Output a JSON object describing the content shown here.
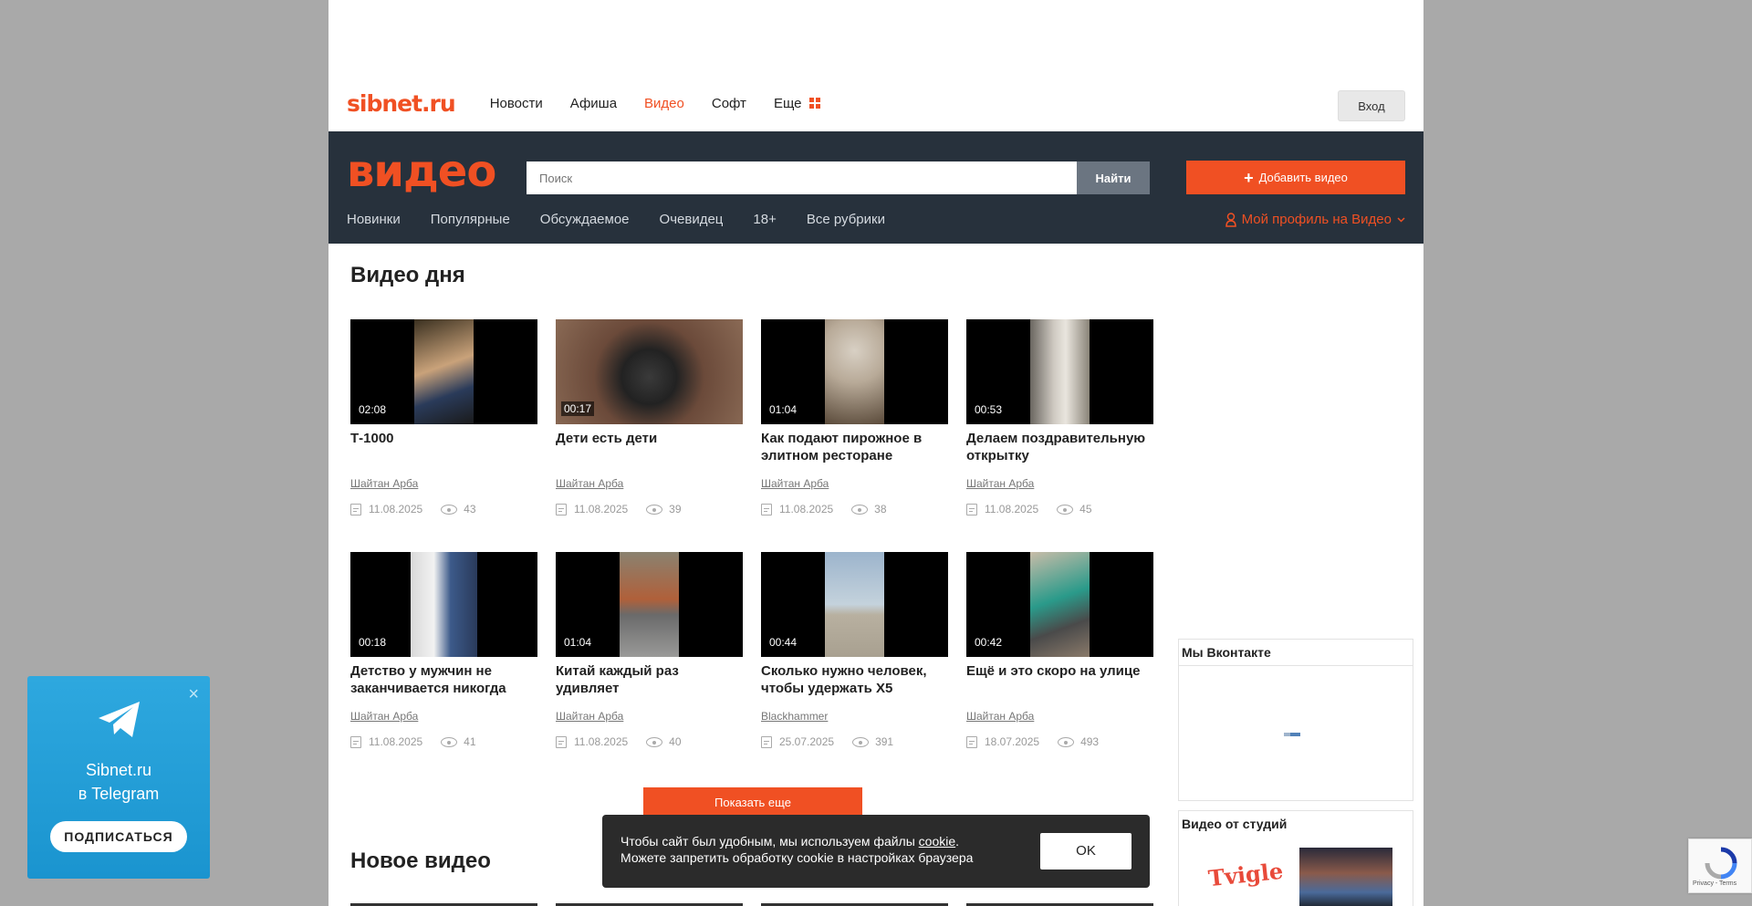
{
  "header": {
    "logo": "sibnet.ru",
    "nav": [
      "Новости",
      "Афиша",
      "Видео",
      "Софт",
      "Еще"
    ],
    "active_nav": "Видео",
    "login": "Вход"
  },
  "video_header": {
    "logo": "видео",
    "search_placeholder": "Поиск",
    "search_button": "Найти",
    "add_button": "Добавить видео",
    "subnav": [
      "Новинки",
      "Популярные",
      "Обсуждаемое",
      "Очевидец",
      "18+",
      "Все рубрики"
    ],
    "profile": "Мой профиль на Видео"
  },
  "sections": {
    "video_of_day": "Видео дня",
    "new_video": "Новое видео",
    "show_more": "Показать еще"
  },
  "videos": [
    {
      "title": "Т-1000",
      "author": "Шайтан Арба",
      "date": "11.08.2025",
      "views": "43",
      "duration": "02:08"
    },
    {
      "title": "Дети есть дети",
      "author": "Шайтан Арба",
      "date": "11.08.2025",
      "views": "39",
      "duration": "00:17"
    },
    {
      "title": "Как подают пирожное в элитном ресторане",
      "author": "Шайтан Арба",
      "date": "11.08.2025",
      "views": "38",
      "duration": "01:04"
    },
    {
      "title": "Делаем поздравительную открытку",
      "author": "Шайтан Арба",
      "date": "11.08.2025",
      "views": "45",
      "duration": "00:53"
    },
    {
      "title": "Детство у мужчин не заканчивается никогда",
      "author": "Шайтан Арба",
      "date": "11.08.2025",
      "views": "41",
      "duration": "00:18"
    },
    {
      "title": "Китай каждый раз удивляет",
      "author": "Шайтан Арба",
      "date": "11.08.2025",
      "views": "40",
      "duration": "01:04"
    },
    {
      "title": "Сколько нужно человек, чтобы удержать Х5",
      "author": "Blackhammer",
      "date": "25.07.2025",
      "views": "391",
      "duration": "00:44"
    },
    {
      "title": "Ещё и это скоро на улице",
      "author": "Шайтан Арба",
      "date": "18.07.2025",
      "views": "493",
      "duration": "00:42"
    }
  ],
  "sidebar": {
    "vk_title": "Мы Вконтакте",
    "studios_title": "Видео от студий",
    "studio_logo": "Tvigle"
  },
  "cookie": {
    "line1_prefix": "Чтобы сайт был удобным, мы используем файлы ",
    "line1_link": "cookie",
    "line1_suffix": ".",
    "line2": "Можете запретить обработку cookie в настройках браузера",
    "ok": "OK"
  },
  "telegram": {
    "line1": "Sibnet.ru",
    "line2": "в Telegram",
    "button": "ПОДПИСАТЬСЯ",
    "close": "×"
  },
  "recaptcha": {
    "text": "Privacy - Terms"
  },
  "colors": {
    "accent": "#f05023",
    "dark_header": "#27313c",
    "telegram": "#2ea8df"
  }
}
